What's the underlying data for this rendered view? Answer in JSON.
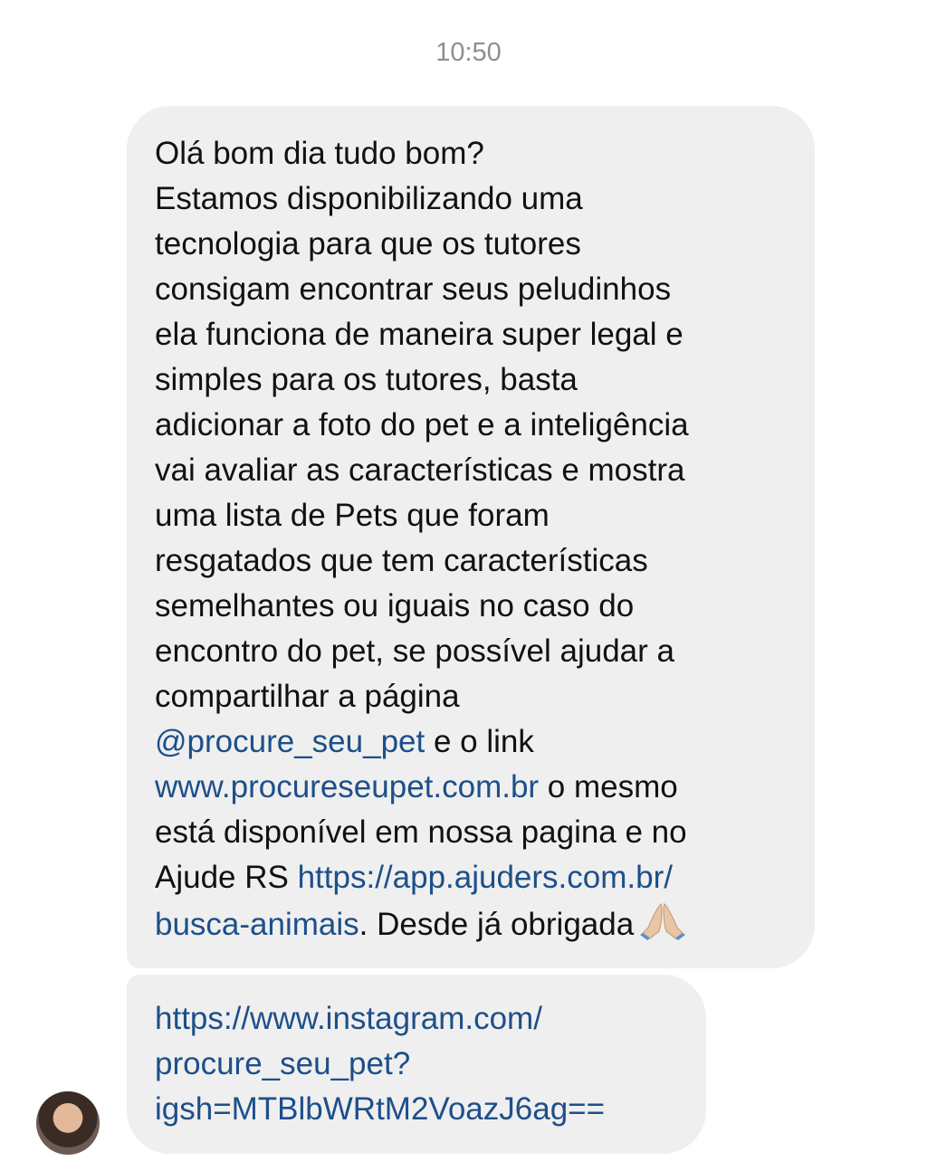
{
  "timestamp": "10:50",
  "message1": {
    "text_a": "Olá bom dia tudo bom?\nEstamos disponibilizando uma\ntecnologia para que os tutores\nconsigam encontrar seus peludinhos\nela funciona de maneira super legal e\nsimples para os tutores, basta\nadicionar a foto do pet e a inteligência\nvai avaliar as características e mostra\numa lista de Pets que foram\nresgatados que tem características\nsemelhantes ou iguais no caso do\nencontro do pet, se possível ajudar a\ncompartilhar a página\n",
    "mention": "@procure_seu_pet",
    "text_b": " e o link\n",
    "site_link": "www.procureseupet.com.br",
    "text_c": " o mesmo\nestá disponível em nossa pagina e no\nAjude RS ",
    "ajuders_link": "https://app.ajuders.com.br/\nbusca-animais",
    "text_d": ". Desde já obrigada",
    "emoji": "folded-hands-icon"
  },
  "message2": {
    "link": "https://www.instagram.com/\nprocure_seu_pet?\nigsh=MTBlbWRtM2VoazJ6ag=="
  },
  "colors": {
    "bubble_bg": "#efefef",
    "link": "#1d4f8a",
    "timestamp": "#8e8e93"
  }
}
